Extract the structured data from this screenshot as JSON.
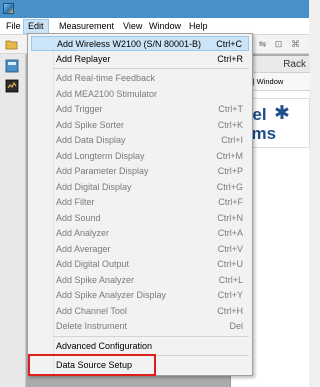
{
  "menubar": {
    "file": "File",
    "edit": "Edit",
    "measurement": "Measurement",
    "view": "View",
    "window": "Window",
    "help": "Help"
  },
  "child_window": {
    "title": "Rack",
    "menu_text": "order | Window",
    "logo_line1": "nel",
    "logo_line2": "ems"
  },
  "edit_menu": {
    "items": [
      {
        "label": "Add Wireless W2100 (S/N 80001-B)",
        "shortcut": "Ctrl+C",
        "enabled": true,
        "highlighted": true
      },
      {
        "label": "Add Replayer",
        "shortcut": "Ctrl+R",
        "enabled": true
      },
      {
        "label": "Add Real-time Feedback",
        "shortcut": "",
        "enabled": false
      },
      {
        "label": "Add MEA2100 Stimulator",
        "shortcut": "",
        "enabled": false
      },
      {
        "label": "Add Trigger",
        "shortcut": "Ctrl+T",
        "enabled": false
      },
      {
        "label": "Add Spike Sorter",
        "shortcut": "Ctrl+K",
        "enabled": false
      },
      {
        "label": "Add Data Display",
        "shortcut": "Ctrl+I",
        "enabled": false
      },
      {
        "label": "Add Longterm Display",
        "shortcut": "Ctrl+M",
        "enabled": false
      },
      {
        "label": "Add Parameter Display",
        "shortcut": "Ctrl+P",
        "enabled": false
      },
      {
        "label": "Add Digital Display",
        "shortcut": "Ctrl+G",
        "enabled": false
      },
      {
        "label": "Add Filter",
        "shortcut": "Ctrl+F",
        "enabled": false
      },
      {
        "label": "Add Sound",
        "shortcut": "Ctrl+N",
        "enabled": false
      },
      {
        "label": "Add Analyzer",
        "shortcut": "Ctrl+A",
        "enabled": false
      },
      {
        "label": "Add Averager",
        "shortcut": "Ctrl+V",
        "enabled": false
      },
      {
        "label": "Add Digital Output",
        "shortcut": "Ctrl+U",
        "enabled": false
      },
      {
        "label": "Add Spike Analyzer",
        "shortcut": "Ctrl+L",
        "enabled": false
      },
      {
        "label": "Add Spike Analyzer Display",
        "shortcut": "Ctrl+Y",
        "enabled": false
      },
      {
        "label": "Add Channel Tool",
        "shortcut": "Ctrl+H",
        "enabled": false
      },
      {
        "label": "Delete Instrument",
        "shortcut": "Del",
        "enabled": false
      },
      {
        "label": "Advanced Configuration",
        "shortcut": "",
        "enabled": true
      },
      {
        "label": "Data Source Setup",
        "shortcut": "",
        "enabled": true,
        "outlined": true
      }
    ]
  },
  "colors": {
    "titlebar": "#4a90c8",
    "highlight": "#cce4f7",
    "outline": "#e01d1d",
    "logo": "#1c4e8a"
  }
}
